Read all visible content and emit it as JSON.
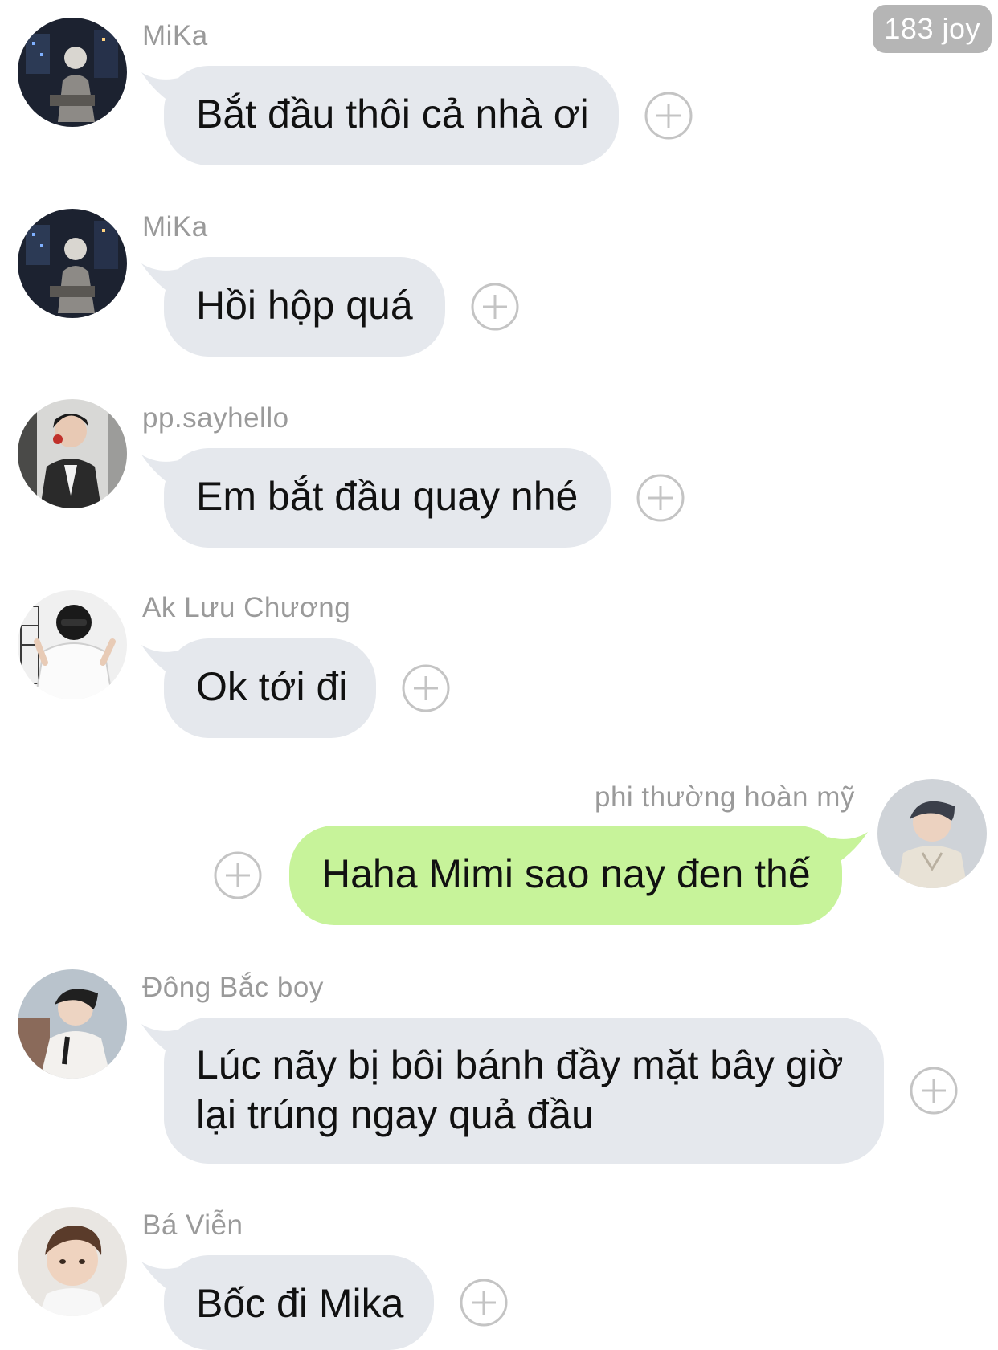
{
  "header": {
    "count_badge": "183 joy"
  },
  "messages": [
    {
      "sender": "MiKa",
      "text": "Bắt đầu thôi cả nhà ơi",
      "side": "incoming"
    },
    {
      "sender": "MiKa",
      "text": "Hồi hộp quá",
      "side": "incoming"
    },
    {
      "sender": "pp.sayhello",
      "text": "Em bắt đầu quay nhé",
      "side": "incoming"
    },
    {
      "sender": "Ak Lưu Chương",
      "text": "Ok tới đi",
      "side": "incoming"
    },
    {
      "sender": "phi thường hoàn mỹ",
      "text": "Haha Mimi sao nay đen thế",
      "side": "outgoing"
    },
    {
      "sender": "Đông Bắc boy",
      "text": "Lúc nãy bị bôi bánh đầy mặt bây giờ lại trúng ngay quả đầu",
      "side": "incoming"
    },
    {
      "sender": "Bá Viễn",
      "text": "Bốc đi Mika",
      "side": "incoming"
    }
  ],
  "icons": {
    "add_reaction": "plus-circle-icon",
    "avatar": "user-photo"
  },
  "colors": {
    "incoming_bubble": "#e5e8ed",
    "outgoing_bubble": "#c7f39a",
    "sender_name": "#9a9a9a",
    "badge_background": "#b5b5b5",
    "plus_stroke": "#c4c4c4"
  }
}
